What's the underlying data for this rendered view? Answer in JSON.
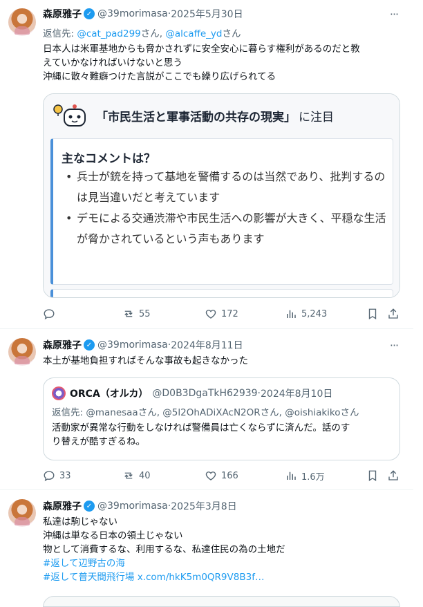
{
  "posts": [
    {
      "author": "森原雅子",
      "handle": "@39morimasa",
      "date": "2025年5月30日",
      "reply_prefix": "返信先: ",
      "reply_user1": "@cat_pad299",
      "reply_san1": "さん, ",
      "reply_user2": "@alcaffe_yd",
      "reply_san2": "さん",
      "text": "日本人は米軍基地からも脅かされずに安全安心に暮らす権利があるのだと教\nえていかなければいけないと思う\n沖縄に散々難癖つけた言説がここでも繰り広げられてる",
      "card": {
        "title": "「市民生活と軍事活動の共存の現実」",
        "title_suffix": "に注目",
        "comment_heading": "主なコメントは？",
        "comments": [
          "兵士が銃を持って基地を警備するのは当然であり、批判するのは見当違いだと考えています",
          "デモによる交通渋滞や市民生活への影響が大きく、平穏な生活が脅かされているという声もあります"
        ]
      },
      "stats": {
        "replies": "",
        "retweets": "55",
        "likes": "172",
        "views": "5,243"
      }
    },
    {
      "author": "森原雅子",
      "handle": "@39morimasa",
      "date": "2024年8月11日",
      "text": "本土が基地負担すればそんな事故も起きなかった",
      "quote": {
        "author": "ORCA（オルカ）",
        "handle": "@D0B3DgaTkH62939",
        "date": "2024年8月10日",
        "reply": "返信先: @manesaaさん, @5l2OhADiXAcN2ORさん, @oishiakikoさん",
        "text": "活動家が異常な行動をしなければ警備員は亡くならずに済んだ。話のす\nり替えが酷すぎるね。"
      },
      "stats": {
        "replies": "33",
        "retweets": "40",
        "likes": "166",
        "views": "1.6万"
      }
    },
    {
      "author": "森原雅子",
      "handle": "@39morimasa",
      "date": "2025年3月8日",
      "lines": [
        "私達は駒じゃない",
        "沖縄は単なる日本の領土じゃない",
        "物として消費するな、利用するな、私達住民の為の土地だ"
      ],
      "hashtags": [
        "#返して辺野古の海",
        "#返して普天間飛行場"
      ],
      "url": "x.com/hkK5m0QR9V8B3f…"
    }
  ],
  "separator": " · ",
  "more_glyph": "···",
  "colors": {
    "accent": "#1d9bf0",
    "muted": "#536471",
    "border": "#cfd9de"
  },
  "icons": [
    "reply-icon",
    "retweet-icon",
    "like-icon",
    "views-icon",
    "bookmark-icon",
    "share-icon",
    "verified-badge-icon",
    "more-icon"
  ]
}
